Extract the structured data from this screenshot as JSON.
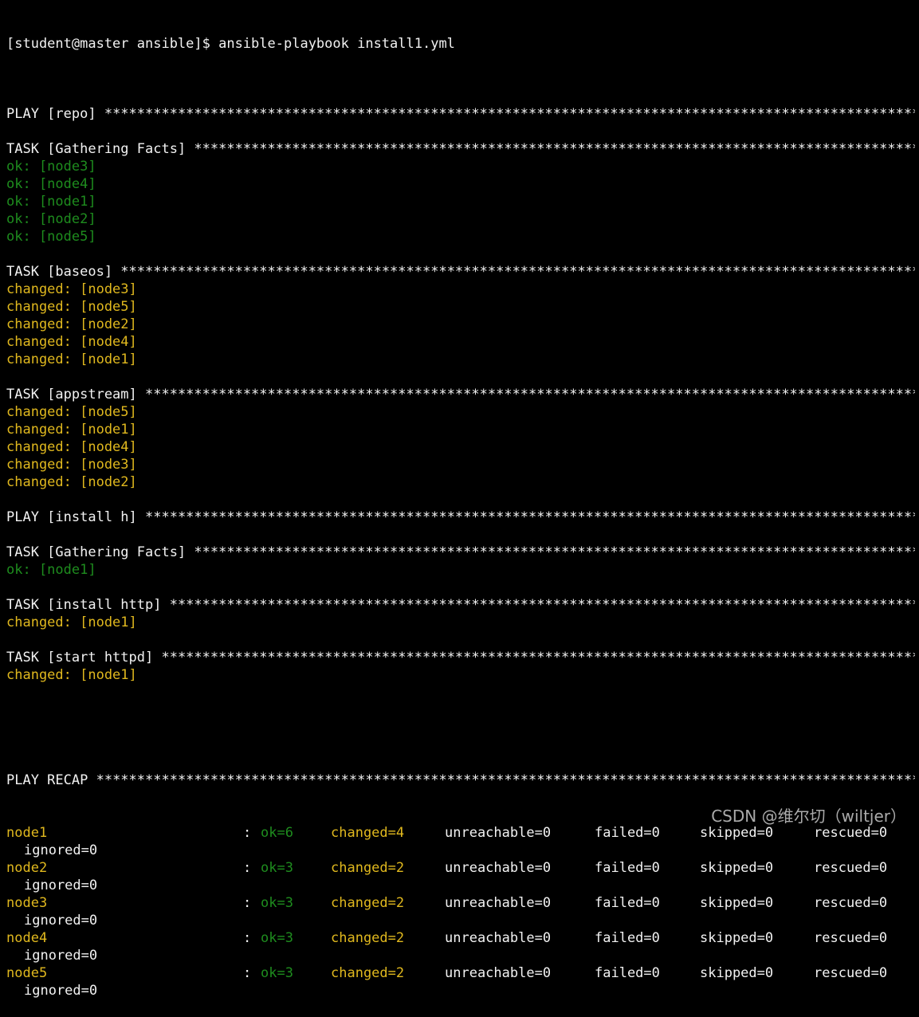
{
  "command_line": "[student@master ansible]$ ansible-playbook install1.yml",
  "stars": "*************************************************************************************************************",
  "blocks": [
    {
      "kind": "header",
      "text": "PLAY [repo] "
    },
    {
      "kind": "header",
      "text": "TASK [Gathering Facts] ",
      "results": [
        {
          "status": "ok",
          "text": "ok: [node3]"
        },
        {
          "status": "ok",
          "text": "ok: [node4]"
        },
        {
          "status": "ok",
          "text": "ok: [node1]"
        },
        {
          "status": "ok",
          "text": "ok: [node2]"
        },
        {
          "status": "ok",
          "text": "ok: [node5]"
        }
      ]
    },
    {
      "kind": "header",
      "text": "TASK [baseos] ",
      "results": [
        {
          "status": "changed",
          "text": "changed: [node3]"
        },
        {
          "status": "changed",
          "text": "changed: [node5]"
        },
        {
          "status": "changed",
          "text": "changed: [node2]"
        },
        {
          "status": "changed",
          "text": "changed: [node4]"
        },
        {
          "status": "changed",
          "text": "changed: [node1]"
        }
      ]
    },
    {
      "kind": "header",
      "text": "TASK [appstream] ",
      "results": [
        {
          "status": "changed",
          "text": "changed: [node5]"
        },
        {
          "status": "changed",
          "text": "changed: [node1]"
        },
        {
          "status": "changed",
          "text": "changed: [node4]"
        },
        {
          "status": "changed",
          "text": "changed: [node3]"
        },
        {
          "status": "changed",
          "text": "changed: [node2]"
        }
      ]
    },
    {
      "kind": "header",
      "text": "PLAY [install h] "
    },
    {
      "kind": "header",
      "text": "TASK [Gathering Facts] ",
      "results": [
        {
          "status": "ok",
          "text": "ok: [node1]"
        }
      ]
    },
    {
      "kind": "header",
      "text": "TASK [install http] ",
      "results": [
        {
          "status": "changed",
          "text": "changed: [node1]"
        }
      ]
    },
    {
      "kind": "header",
      "text": "TASK [start httpd] ",
      "results": [
        {
          "status": "changed",
          "text": "changed: [node1]"
        }
      ]
    }
  ],
  "recap_header": "PLAY RECAP ",
  "recap": [
    {
      "host": "node1",
      "ok": "ok=6",
      "changed": "changed=4",
      "unreachable": "unreachable=0",
      "failed": "failed=0",
      "skipped": "skipped=0",
      "rescued": "rescued=0",
      "ignored": "ignored=0"
    },
    {
      "host": "node2",
      "ok": "ok=3",
      "changed": "changed=2",
      "unreachable": "unreachable=0",
      "failed": "failed=0",
      "skipped": "skipped=0",
      "rescued": "rescued=0",
      "ignored": "ignored=0"
    },
    {
      "host": "node3",
      "ok": "ok=3",
      "changed": "changed=2",
      "unreachable": "unreachable=0",
      "failed": "failed=0",
      "skipped": "skipped=0",
      "rescued": "rescued=0",
      "ignored": "ignored=0"
    },
    {
      "host": "node4",
      "ok": "ok=3",
      "changed": "changed=2",
      "unreachable": "unreachable=0",
      "failed": "failed=0",
      "skipped": "skipped=0",
      "rescued": "rescued=0",
      "ignored": "ignored=0"
    },
    {
      "host": "node5",
      "ok": "ok=3",
      "changed": "changed=2",
      "unreachable": "unreachable=0",
      "failed": "failed=0",
      "skipped": "skipped=0",
      "rescued": "rescued=0",
      "ignored": "ignored=0"
    }
  ],
  "colon": ":",
  "watermark": "CSDN @维尔切（wiltjer）",
  "colors": {
    "background": "#000000",
    "text": "#f2f2f2",
    "ok": "#1e8c1e",
    "changed": "#e0b81e"
  }
}
